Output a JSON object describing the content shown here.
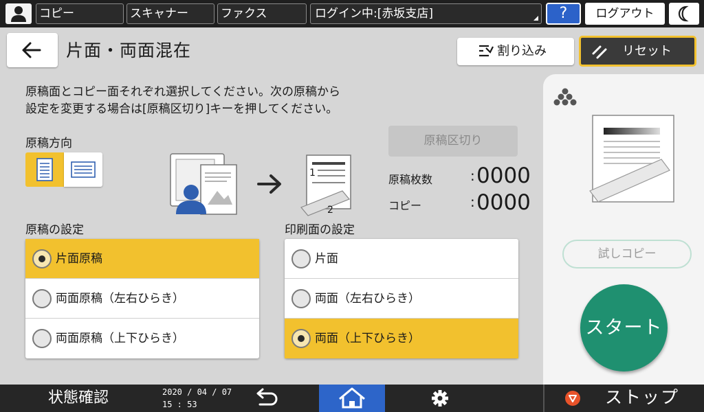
{
  "topbar": {
    "tabs": [
      "コピー",
      "スキャナー",
      "ファクス"
    ],
    "login": "ログイン中:[赤坂支店]",
    "help": "?",
    "logout": "ログアウト"
  },
  "header": {
    "title": "片面・両面混在",
    "interrupt": "割り込み",
    "reset": "リセット"
  },
  "instructions": [
    "原稿面とコピー面それぞれ選択してください。次の原稿から",
    "設定を変更する場合は[原稿区切り]キーを押してください。"
  ],
  "orientation_label": "原稿方向",
  "separator_button": "原稿区切り",
  "diagram_page_numbers": [
    "1",
    "2"
  ],
  "counters": {
    "originals_label": "原稿枚数",
    "originals_value": "0000",
    "copies_label": "コピー",
    "copies_value": "0000",
    "colon": ":"
  },
  "original_settings": {
    "label": "原稿の設定",
    "options": [
      "片面原稿",
      "両面原稿（左右ひらき）",
      "両面原稿（上下ひらき）"
    ],
    "selected_index": 0
  },
  "print_settings": {
    "label": "印刷面の設定",
    "options": [
      "片面",
      "両面（左右ひらき）",
      "両面（上下ひらき）"
    ],
    "selected_index": 2
  },
  "right_panel": {
    "trial_copy": "試しコピー",
    "start": "スタート"
  },
  "bottombar": {
    "status": "状態確認",
    "date": "2020 / 04 / 07",
    "time": "15 : 53",
    "stop": "ストップ"
  },
  "colors": {
    "accent_yellow": "#f2c12e",
    "start_green": "#1f9070",
    "home_blue": "#2d65c9"
  }
}
